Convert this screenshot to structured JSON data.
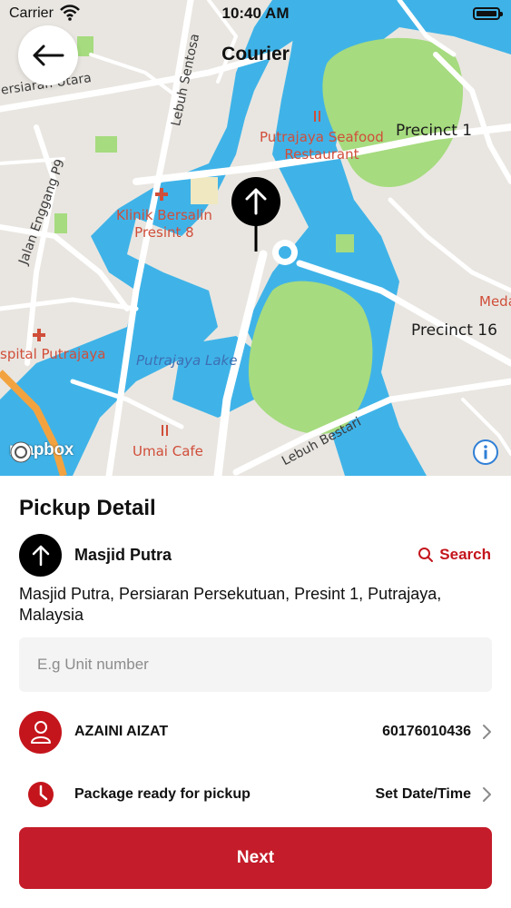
{
  "status_bar": {
    "carrier": "Carrier",
    "time": "10:40 AM"
  },
  "nav": {
    "title": "Courier",
    "back_icon": "arrow-left-icon"
  },
  "map": {
    "labels": {
      "persiaran_utara": "ersiaran Utara",
      "lebuh_sentosa": "Lebuh Sentosa",
      "jalan_enggang": "Jalan Enggang P9",
      "seafood_line1": "Putrajaya Seafood",
      "seafood_line2": "Restaurant",
      "precinct1": "Precinct 1",
      "klinik_line1": "Klinik Bersalin",
      "klinik_line2": "Presint 8",
      "media": "Meda",
      "precinct16": "Precinct 16",
      "hospital": "spital Putrajaya",
      "lake": "Putrajaya Lake",
      "lebuh_bestari": "Lebuh Bestari",
      "umai": "Umai Cafe"
    },
    "attribution": "mapbox",
    "colors": {
      "land": "#e9e6e1",
      "water": "#3fb3e8",
      "park": "#a6db7f",
      "road": "#ffffff",
      "poi": "#d04e3a"
    }
  },
  "pickup": {
    "title": "Pickup Detail",
    "location_name": "Masjid Putra",
    "search_label": "Search",
    "address": "Masjid Putra, Persiaran Persekutuan, Presint 1, Putrajaya, Malaysia",
    "unit_placeholder": "E.g Unit number",
    "unit_value": "",
    "contact_name": "AZAINI AIZAT",
    "contact_phone": "60176010436",
    "ready_label": "Package ready for pickup",
    "ready_value": "Set Date/Time",
    "next_label": "Next"
  },
  "colors": {
    "accent": "#c4151c",
    "button": "#c41c2a",
    "input_bg": "#f4f4f5"
  }
}
